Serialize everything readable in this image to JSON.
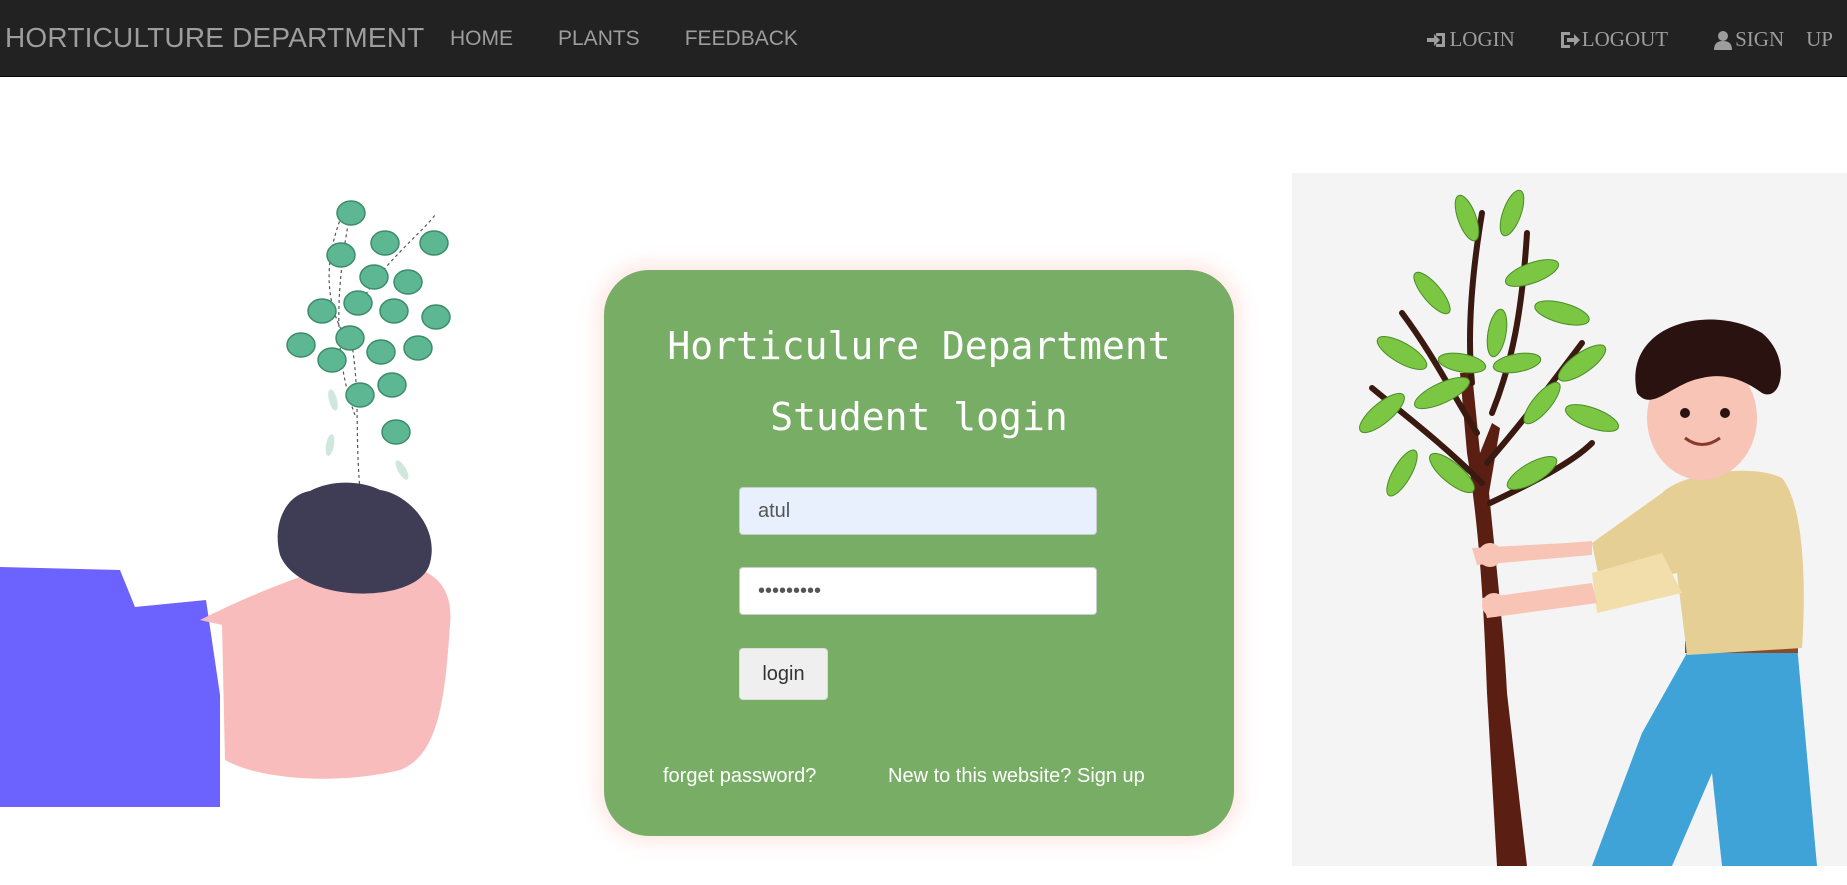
{
  "navbar": {
    "brand": "HORTICULTURE DEPARTMENT",
    "links": [
      "HOME",
      "PLANTS",
      "FEEDBACK"
    ],
    "login_label": "LOGIN",
    "logout_label": "LOGOUT",
    "signup_label_1": "SIGN",
    "signup_label_2": "UP",
    "background": "#222222",
    "text_color": "#9d9d9d"
  },
  "card": {
    "title": "Horticulure Department",
    "subtitle": "Student login",
    "username_value": "atul",
    "password_value": "*********",
    "login_button": "login",
    "forget_link": "forget password?",
    "signup_link": "New to this website? Sign up",
    "background": "#78ad66"
  },
  "icons": [
    "login-icon",
    "logout-icon",
    "user-icon"
  ]
}
